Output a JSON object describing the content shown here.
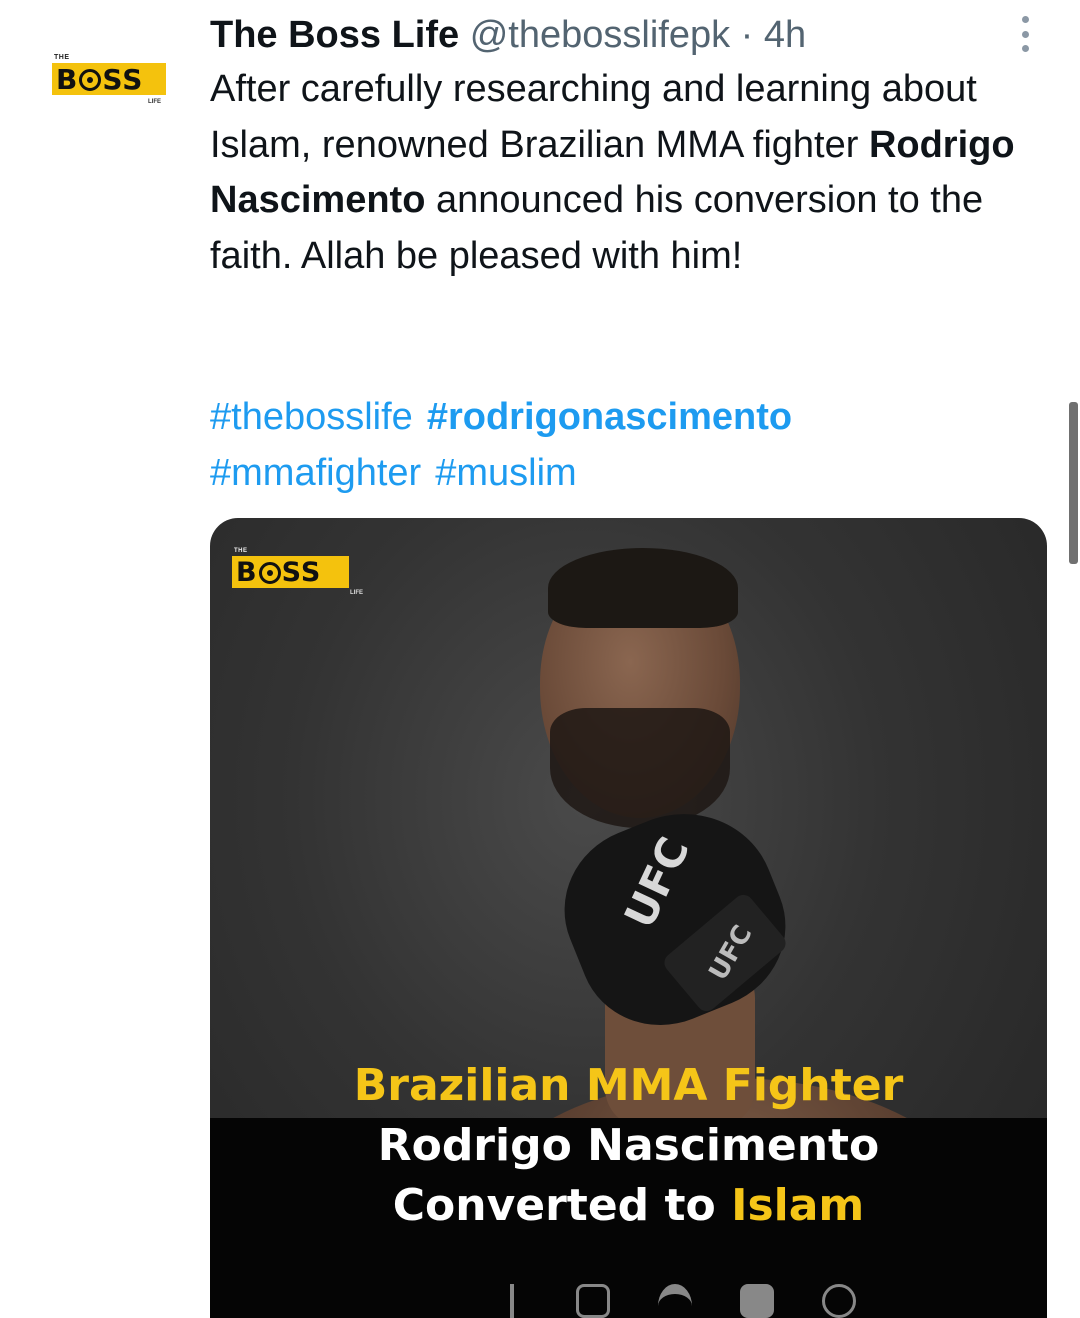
{
  "account": {
    "display_name": "The Boss Life",
    "handle": "@thebosslifepk",
    "separator": "·",
    "time": "4h",
    "logo": {
      "top": "THE",
      "main": "BOSS",
      "bottom": "LIFE"
    }
  },
  "tweet": {
    "text_before": "After carefully researching and learning about Islam, renowned Brazilian MMA fighter ",
    "text_bold": "Rodrigo Nascimento",
    "text_after": " announced his conversion to the faith. Allah be pleased with him!",
    "hashtags": [
      "#thebosslife",
      "#rodrigonascimento",
      "#mmafighter",
      "#muslim"
    ]
  },
  "media": {
    "logo": {
      "top": "THE",
      "main": "BOSS",
      "bottom": "LIFE"
    },
    "glove_text_1": "UFC",
    "glove_text_2": "UFC",
    "caption_line1": "Brazilian MMA Fighter",
    "caption_line2": "Rodrigo Nascimento",
    "caption_line3_a": "Converted to ",
    "caption_line3_b": "Islam",
    "social_icons": [
      "facebook-icon",
      "instagram-icon",
      "twitter-icon",
      "linkedin-icon",
      "globe-icon"
    ]
  },
  "colors": {
    "link": "#1d9bf0",
    "secondary_text": "#536471",
    "brand_yellow": "#f4c20d",
    "caption_yellow": "#f5c518"
  }
}
